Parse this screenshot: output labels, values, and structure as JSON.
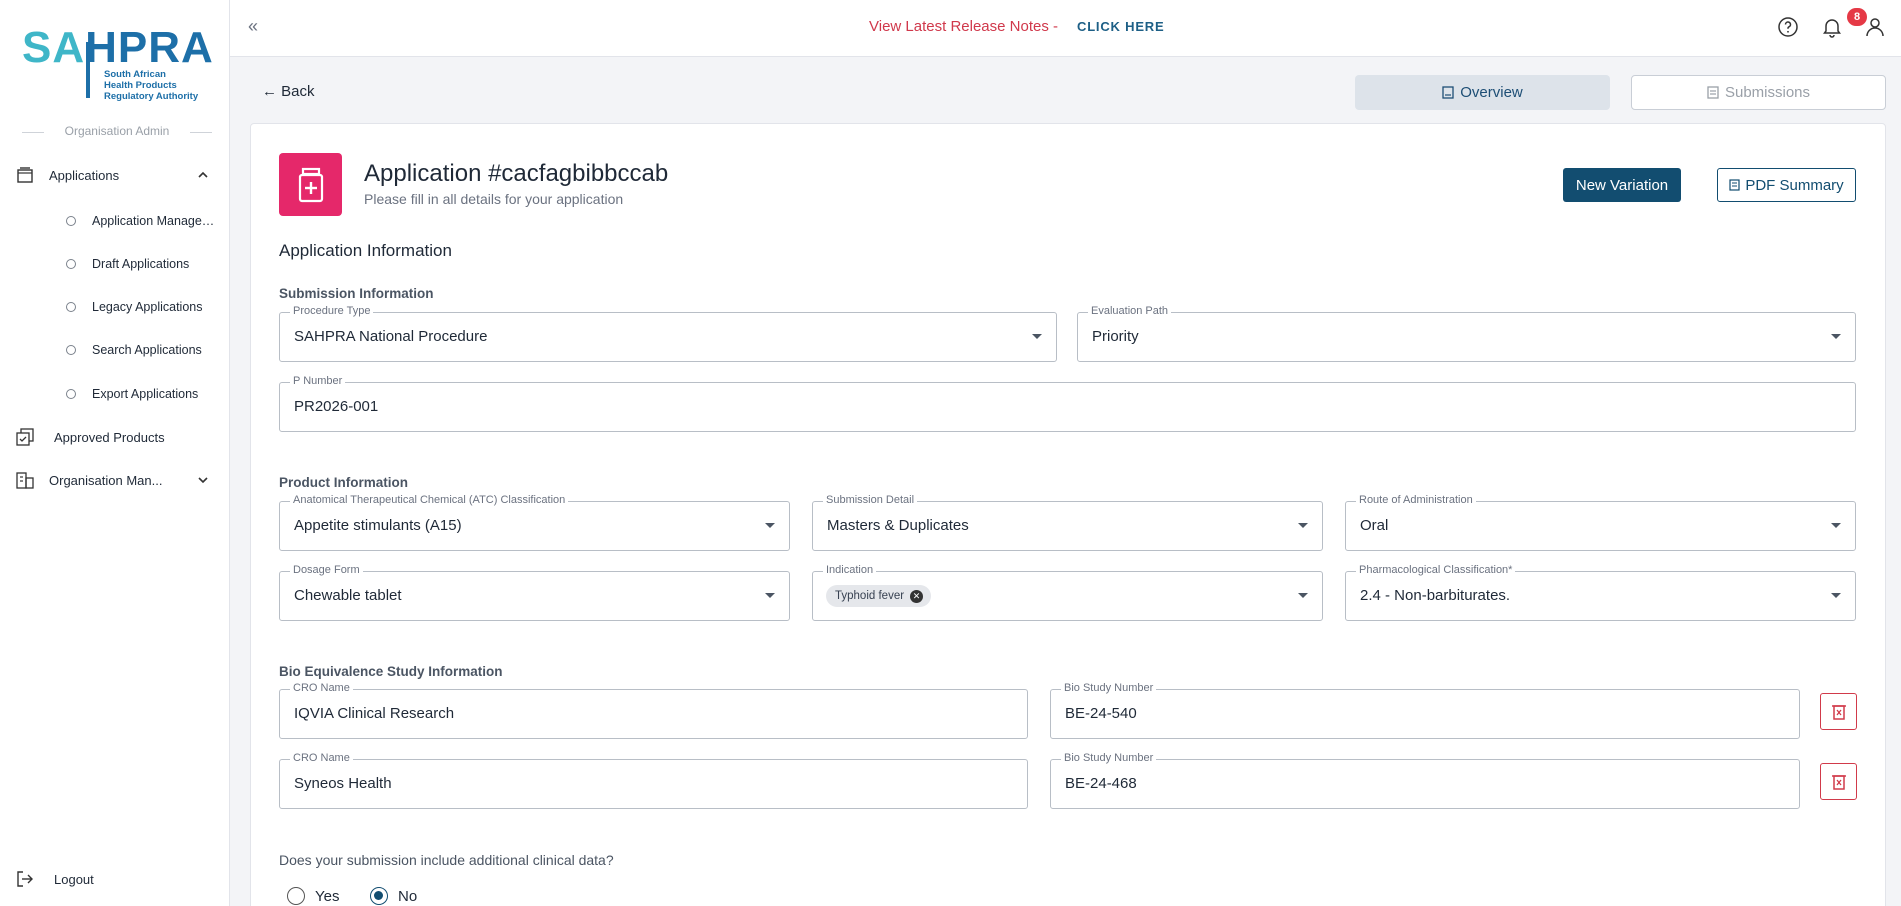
{
  "sidebar": {
    "logo": {
      "text_sa": "SA",
      "text_hpra": "HPRA",
      "tagline": [
        "South African",
        "Health Products",
        "Regulatory Authority"
      ]
    },
    "role": "Organisation Admin",
    "items": [
      {
        "label": "Applications",
        "icon": "stack-icon",
        "expanded": true
      },
      {
        "label": "Approved Products",
        "icon": "approved-icon"
      },
      {
        "label": "Organisation Man...",
        "icon": "building-icon",
        "expanded": false
      }
    ],
    "sub_items": [
      {
        "label": "Application Management"
      },
      {
        "label": "Draft Applications"
      },
      {
        "label": "Legacy Applications"
      },
      {
        "label": "Search Applications"
      },
      {
        "label": "Export Applications"
      }
    ],
    "logout": "Logout"
  },
  "topbar": {
    "collapse": "«",
    "release_text": "View Latest Release Notes -",
    "release_link": "CLICK HERE",
    "notification_count": "8"
  },
  "header": {
    "back": "Back",
    "tabs": [
      {
        "label": "Overview"
      },
      {
        "label": "Submissions"
      }
    ]
  },
  "application": {
    "title": "Application #cacfagbibbccab",
    "subtitle": "Please fill in all details for your application",
    "new_variation": "New Variation",
    "pdf_summary": "PDF Summary",
    "section_title": "Application Information"
  },
  "submission_info": {
    "heading": "Submission Information",
    "procedure_type": {
      "label": "Procedure Type",
      "value": "SAHPRA National Procedure"
    },
    "evaluation_path": {
      "label": "Evaluation Path",
      "value": "Priority"
    },
    "p_number": {
      "label": "P Number",
      "value": "PR2026-001"
    }
  },
  "product_info": {
    "heading": "Product Information",
    "atc": {
      "label": "Anatomical Therapeutical Chemical (ATC) Classification",
      "value": "Appetite stimulants (A15)"
    },
    "submission_detail": {
      "label": "Submission Detail",
      "value": "Masters & Duplicates"
    },
    "route": {
      "label": "Route of Administration",
      "value": "Oral"
    },
    "dosage_form": {
      "label": "Dosage Form",
      "value": "Chewable tablet"
    },
    "indication": {
      "label": "Indication",
      "chips": [
        "Typhoid fever"
      ]
    },
    "pharmacological": {
      "label": "Pharmacological Classification*",
      "value": "2.4 - Non-barbiturates."
    }
  },
  "bio_info": {
    "heading": "Bio Equivalence Study Information",
    "rows": [
      {
        "cro_label": "CRO Name",
        "cro": "IQVIA Clinical Research",
        "bio_label": "Bio Study Number",
        "bio": "BE-24-540"
      },
      {
        "cro_label": "CRO Name",
        "cro": "Syneos Health",
        "bio_label": "Bio Study Number",
        "bio": "BE-24-468"
      }
    ]
  },
  "clinical": {
    "question": "Does your submission include additional clinical data?",
    "options": [
      "Yes",
      "No"
    ],
    "selected": "No"
  }
}
